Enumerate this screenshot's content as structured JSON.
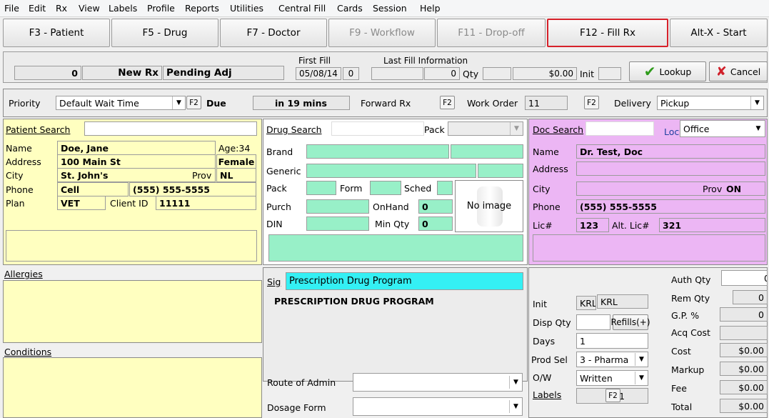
{
  "menu": [
    "File",
    "Edit",
    "Rx",
    "View",
    "Labels",
    "Profile",
    "Reports",
    "Utilities",
    "Central Fill",
    "Cards",
    "Session",
    "Help"
  ],
  "fkeys": [
    "F3 - Patient",
    "F5 - Drug",
    "F7 - Doctor",
    "F9 - Workflow",
    "F11 - Drop-off",
    "F12 - Fill Rx",
    "Alt-X - Start"
  ],
  "status": {
    "count": "0",
    "rx_type": "New Rx",
    "adj": "Pending Adj",
    "first_fill_label": "First Fill",
    "first_fill_date": "05/08/14",
    "first_fill_num": "0",
    "last_fill_label": "Last Fill Information",
    "last_qty_value": "0",
    "qty_label": "Qty",
    "amount": "$0.00",
    "init_label": "Init",
    "lookup": "Lookup",
    "cancel": "Cancel"
  },
  "priority_row": {
    "priority_label": "Priority",
    "priority_value": "Default Wait Time",
    "f2": "F2",
    "due_label": "Due",
    "due_value": "in 19 mins",
    "forward_rx": "Forward Rx",
    "work_order_label": "Work Order",
    "work_order_value": "11",
    "delivery_label": "Delivery",
    "delivery_value": "Pickup"
  },
  "patient": {
    "search_label": "Patient Search",
    "name_label": "Name",
    "name": "Doe, Jane",
    "age": "Age:34",
    "address_label": "Address",
    "address": "100 Main St",
    "gender": "Female",
    "city_label": "City",
    "city": "St. John's",
    "prov_label": "Prov",
    "prov": "NL",
    "phone_label": "Phone",
    "phone_type": "Cell",
    "phone": "(555) 555-5555",
    "plan_label": "Plan",
    "plan": "VET",
    "client_label": "Client ID",
    "client_id": "11111",
    "allergies_label": "Allergies",
    "conditions_label": "Conditions"
  },
  "drug": {
    "search_label": "Drug Search",
    "pack_label": "Pack",
    "brand_label": "Brand",
    "generic_label": "Generic",
    "pack2_label": "Pack",
    "form_label": "Form",
    "sched_label": "Sched",
    "purch_label": "Purch",
    "onhand_label": "OnHand",
    "onhand": "0",
    "din_label": "DIN",
    "minqty_label": "Min Qty",
    "minqty": "0",
    "no_image": "No image",
    "sig_label": "Sig",
    "sig_value": "Prescription Drug Program",
    "sig_text": "PRESCRIPTION DRUG PROGRAM",
    "route_label": "Route of Admin",
    "dosage_label": "Dosage Form"
  },
  "doctor": {
    "search_label": "Doc Search",
    "loc_label": "Loc",
    "loc_value": "Office",
    "name_label": "Name",
    "name": "Dr. Test, Doc",
    "address_label": "Address",
    "city_label": "City",
    "prov_label": "Prov",
    "prov": "ON",
    "phone_label": "Phone",
    "phone": "(555) 555-5555",
    "lic_label": "Lic#",
    "lic": "123",
    "alt_lic_label": "Alt. Lic#",
    "alt_lic": "321"
  },
  "fill": {
    "init_label": "Init",
    "init1": "KRL",
    "init2": "KRL",
    "disp_qty_label": "Disp Qty",
    "refills": "Refills(+)",
    "days_label": "Days",
    "days": "1",
    "prod_sel_label": "Prod Sel",
    "prod_sel": "3 - Pharma",
    "ow_label": "O/W",
    "ow": "Written",
    "labels_label": "Labels",
    "labels": "1",
    "auth_qty_label": "Auth Qty",
    "auth_qty": "0",
    "rem_qty_label": "Rem Qty",
    "rem_qty": "0",
    "gp_label": "G.P. %",
    "gp": "0",
    "acq_cost_label": "Acq Cost",
    "cost_label": "Cost",
    "cost": "$0.00",
    "markup_label": "Markup",
    "markup": "$0.00",
    "fee_label": "Fee",
    "fee": "$0.00",
    "total_label": "Total",
    "total": "$0.00"
  }
}
